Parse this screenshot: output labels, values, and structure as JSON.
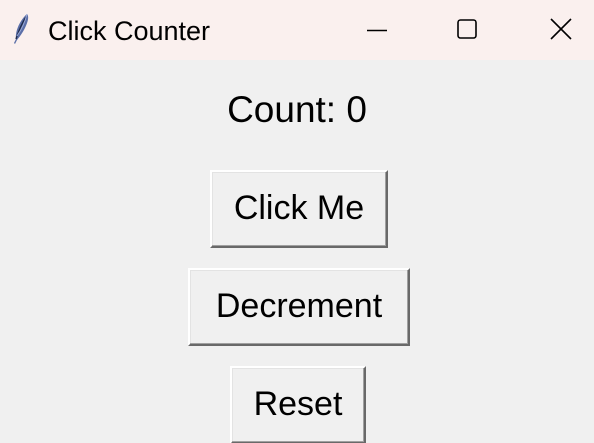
{
  "window": {
    "title": "Click Counter",
    "icon": "feather-icon"
  },
  "controls": {
    "minimize_icon": "minimize-icon",
    "maximize_icon": "maximize-icon",
    "close_icon": "close-icon"
  },
  "counter": {
    "label": "Count: 0"
  },
  "buttons": {
    "click_label": "Click Me",
    "decrement_label": "Decrement",
    "reset_label": "Reset"
  },
  "colors": {
    "titlebar_bg": "#faf0ee",
    "window_bg": "#f0f0f0"
  }
}
